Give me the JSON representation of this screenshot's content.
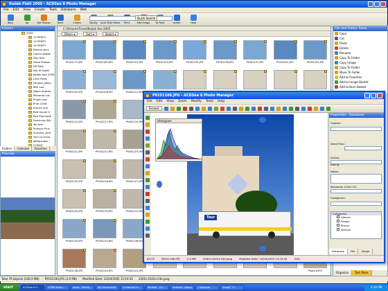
{
  "main_window": {
    "title": "Kodak Flatt 2005 - ACDSee 8 Photo Manager",
    "menu": [
      "File",
      "Edit",
      "View",
      "Create",
      "Tools",
      "Database",
      "Web"
    ],
    "toolbar": [
      {
        "label": "Back",
        "color": "#3a78d8"
      },
      {
        "label": "Up",
        "color": "#3a9a30"
      },
      {
        "label": "Get Photos",
        "color": "#d87a20"
      },
      {
        "label": "Send",
        "color": "#2a6ab8"
      },
      {
        "label": "Create",
        "color": "#d8a020"
      },
      {
        "label": "Modify",
        "color": "#3a8ad8"
      },
      {
        "label": "Auto Slide Show",
        "color": "#80a030"
      },
      {
        "label": "Print",
        "color": "#5a5a7a"
      },
      {
        "label": "Edit Image",
        "color": "#c04030"
      },
      {
        "label": "To Fault",
        "color": "#4a90c0"
      },
      {
        "label": "AcdID",
        "color": "#2070d0"
      },
      {
        "label": "Help",
        "color": "#3a80e0"
      }
    ],
    "quick_search_label": "Quick Search"
  },
  "folders": {
    "title": "Folders",
    "items": [
      "2005",
      "12 PENTY",
      "13 PENTY",
      "15 PENTY",
      "Athens_bics",
      "Canon Kodak",
      "Day files",
      "Good Photos",
      "HP Sets",
      "Isle of Inglei",
      "Kodak Ave 2005",
      "Lace Pools",
      "London_jakov",
      "Milk Leo",
      "Nokia Andrea",
      "Personal Lok",
      "Photo Lest",
      "Print 2006",
      "Rincon kuri",
      "Red mover 5",
      "Red Plymouth",
      "Samsung Sky",
      "Tel Aviv",
      "Science Plus",
      "Summer_bird",
      "Turn to Drive",
      "wPopunato",
      "CODEZ"
    ],
    "tabs": [
      "Folders",
      "Calendar",
      "Favorites"
    ],
    "preview_title": "Preview"
  },
  "browser": {
    "address": "C:\\Pictures\\Travel\\Kodak Ave 2005",
    "filters": [
      "Filters",
      "Sort",
      "Select"
    ],
    "thumbs": [
      {
        "cap": "P9161172.JPG",
        "color": "#7aa8d0"
      },
      {
        "cap": "P9161185.JPG",
        "color": "#6a98c8"
      },
      {
        "cap": "P9161191.JPG",
        "color": "#5a88c0"
      },
      {
        "cap": "P9161193.JPG",
        "color": "#6a98c8"
      },
      {
        "cap": "P9161195.JPG",
        "color": "#7aa8d8"
      },
      {
        "cap": "P9161196.JPG",
        "color": "#6a98c8"
      },
      {
        "cap": "P9161197.JPG",
        "color": "#7aa8d0"
      },
      {
        "cap": "P9161201.JPG",
        "color": "#5a88c0"
      },
      {
        "cap": "P9161203.JPG",
        "color": "#6a98c8"
      },
      {
        "cap": "P9161205.JPG",
        "color": "#8ab0d8"
      },
      {
        "cap": "P9161208.JPG",
        "color": "#9ab8d8"
      },
      {
        "cap": "P9161211.JPG",
        "color": "#6a98c8"
      },
      {
        "cap": "P9161213.JPG",
        "color": "#8ab0d0"
      },
      {
        "cap": "",
        "color": "#d8d0c0"
      },
      {
        "cap": "",
        "color": "#d8d0c0"
      },
      {
        "cap": "",
        "color": "#d8d0c0"
      },
      {
        "cap": "",
        "color": "#d8d0c0"
      },
      {
        "cap": "",
        "color": "#d8d0c0"
      },
      {
        "cap": "P9161215.JPG",
        "color": "#8898a8"
      },
      {
        "cap": "P9161217.JPG",
        "color": "#b0a890"
      },
      {
        "cap": "P9161219.JPG",
        "color": "#a8b8c8"
      },
      {
        "cap": "",
        "color": "#d8d0c0"
      },
      {
        "cap": "",
        "color": "#d8d0c0"
      },
      {
        "cap": "",
        "color": "#d8d0c0"
      },
      {
        "cap": "",
        "color": "#d8d0c0"
      },
      {
        "cap": "",
        "color": "#d8d0c0"
      },
      {
        "cap": "",
        "color": "#d8d0c0"
      },
      {
        "cap": "P9161221.JPG",
        "color": "#b8b0a0"
      },
      {
        "cap": "P9161222.JPG",
        "color": "#c0b8a8"
      },
      {
        "cap": "P9161223.JPG",
        "color": "#a8a090"
      },
      {
        "cap": "",
        "color": "#d8d0c0"
      },
      {
        "cap": "",
        "color": "#d8d0c0"
      },
      {
        "cap": "",
        "color": "#d8d0c0"
      },
      {
        "cap": "",
        "color": "#d8d0c0"
      },
      {
        "cap": "",
        "color": "#d8d0c0"
      },
      {
        "cap": "",
        "color": "#d8d0c0"
      },
      {
        "cap": "P9161225.JPG",
        "color": "#c8c0b0"
      },
      {
        "cap": "P9161226.JPG",
        "color": "#b8b0a0"
      },
      {
        "cap": "P9161227.JPG",
        "color": "#c0b8a8"
      },
      {
        "cap": "",
        "color": "#d8d0c0"
      },
      {
        "cap": "",
        "color": "#d8d0c0"
      },
      {
        "cap": "",
        "color": "#d8d0c0"
      },
      {
        "cap": "",
        "color": "#d8d0c0"
      },
      {
        "cap": "",
        "color": "#d8d0c0"
      },
      {
        "cap": "",
        "color": "#d8d0c0"
      },
      {
        "cap": "P9161229.JPG",
        "color": "#c8c0b0"
      },
      {
        "cap": "P9161230.JPG",
        "color": "#b8b0a0"
      },
      {
        "cap": "P9161231.JPG",
        "color": "#c0b8a8"
      },
      {
        "cap": "",
        "color": "#d8d0c0"
      },
      {
        "cap": "",
        "color": "#d8d0c0"
      },
      {
        "cap": "",
        "color": "#d8d0c0"
      },
      {
        "cap": "",
        "color": "#d8d0c0"
      },
      {
        "cap": "",
        "color": "#d8d0c0"
      },
      {
        "cap": "",
        "color": "#d8d0c0"
      },
      {
        "cap": "P9161233.JPG",
        "color": "#8aa8c8"
      },
      {
        "cap": "P9161234.JPG",
        "color": "#7a98b8"
      },
      {
        "cap": "P9161236.JPG",
        "color": "#8aa8c8"
      },
      {
        "cap": "",
        "color": "#d8d0c0"
      },
      {
        "cap": "",
        "color": "#d8d0c0"
      },
      {
        "cap": "",
        "color": "#d8d0c0"
      },
      {
        "cap": "",
        "color": "#d8d0c0"
      },
      {
        "cap": "",
        "color": "#d8d0c0"
      },
      {
        "cap": "",
        "color": "#d8d0c0"
      },
      {
        "cap": "P9161238.JPG",
        "color": "#a87858"
      },
      {
        "cap": "P9161240.JPG",
        "color": "#b8a890"
      },
      {
        "cap": "P9161241.JPG",
        "color": "#b0a080"
      },
      {
        "cap": "",
        "color": "#d8d0c0"
      },
      {
        "cap": "",
        "color": "#d8d0c0"
      },
      {
        "cap": "",
        "color": "#d8d0c0"
      },
      {
        "cap": "",
        "color": "#d8d0c0"
      },
      {
        "cap": "",
        "color": "#d8d0c0"
      },
      {
        "cap": "Photo 8.JPG",
        "color": "#c8b8a0"
      }
    ]
  },
  "tasks": {
    "title": "File and Folder Tasks",
    "items": [
      {
        "label": "Copy",
        "color": "#d8a020"
      },
      {
        "label": "Cut",
        "color": "#5a5a7a"
      },
      {
        "label": "Paste",
        "color": "#d8a020"
      },
      {
        "label": "Delete",
        "color": "#d04030"
      },
      {
        "label": "Rename",
        "color": "#3a80d0"
      },
      {
        "label": "Copy To Folder",
        "color": "#d8a020"
      },
      {
        "label": "Copy Image",
        "color": "#3a80d0"
      },
      {
        "label": "Copy To Folder",
        "color": "#d8a020"
      },
      {
        "label": "Move To Folder",
        "color": "#d8a020"
      },
      {
        "label": "Add to Favorites",
        "color": "#e0c020"
      },
      {
        "label": "Add to Image Basket",
        "color": "#3a9a30"
      },
      {
        "label": "Add to Burn Basket",
        "color": "#d04030"
      }
    ],
    "bottom_tabs": [
      "Organize",
      "Task Pane"
    ]
  },
  "status": {
    "items": [
      "Total 79 objects (246.9 MB)",
      "P9161184.JPG (2.9 MB)",
      "Modified Date: 10/29/2005 13:19:35",
      "2560×1920×24b jpeg"
    ]
  },
  "viewer": {
    "title": "P9151186.JPG - ACDSee 8 Photo Manager",
    "menu": [
      "File",
      "Edit",
      "View",
      "Zoom",
      "Modify",
      "Tools",
      "Help"
    ],
    "browse_label": "Browse",
    "histogram_title": "Histogram",
    "props_title": "Properties - Database",
    "fields": [
      "Caption:",
      "Date/Time:",
      "Author:",
      "Rating:",
      "Notes:",
      "Keywords (Cntrl+K):",
      "Categories:"
    ],
    "categories_title": "Categories",
    "categories": [
      "Albums",
      "People",
      "Places",
      "Various"
    ],
    "tabs": [
      "Database",
      "File",
      "Image"
    ],
    "status": [
      "62/79",
      "P9151186.JPG",
      "2.9 MB",
      "2560×1920×24b jpeg",
      "Modified Date: 10/29/2005 13:19:45",
      "34%"
    ]
  },
  "taskbar": {
    "start": "start",
    "items": [
      "ACDSee 8.0...",
      "4 PPIS Mixtu...",
      "Inbox - Micros...",
      "My Documents",
      "2 Internet Ex...",
      "TextPad - [D:\\...",
      "Untitled - Notep...",
      "2 Notepad",
      "SnagIT 7.0"
    ],
    "clock": "4:10 PM"
  }
}
